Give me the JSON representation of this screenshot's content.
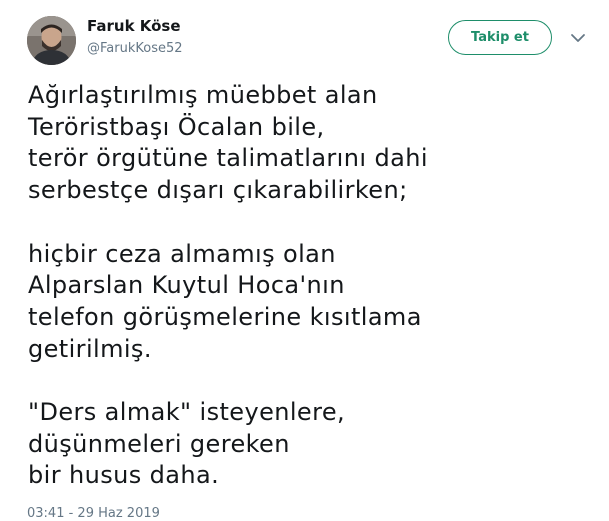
{
  "author": {
    "name": "Faruk Köse",
    "handle": "@FarukKose52"
  },
  "follow_button": {
    "label": "Takip et"
  },
  "more_menu": {
    "icon": "chevron-down-icon"
  },
  "tweet": {
    "paragraphs": [
      [
        "Ağırlaştırılmış müebbet alan",
        "Teröristbaşı Öcalan bile,",
        "terör örgütüne talimatlarını dahi",
        "serbestçe dışarı çıkarabilirken;"
      ],
      [
        "hiçbir ceza almamış olan",
        "Alparslan Kuytul Hoca'nın",
        "telefon görüşmelerine kısıtlama",
        "getirilmiş."
      ],
      [
        "\"Ders almak\" isteyenlere,",
        "düşünmeleri gereken",
        "bir husus daha."
      ]
    ],
    "timestamp": "03:41 - 29 Haz 2019"
  },
  "colors": {
    "accent": "#1e8e6a",
    "text": "#14171a",
    "muted": "#657786"
  }
}
